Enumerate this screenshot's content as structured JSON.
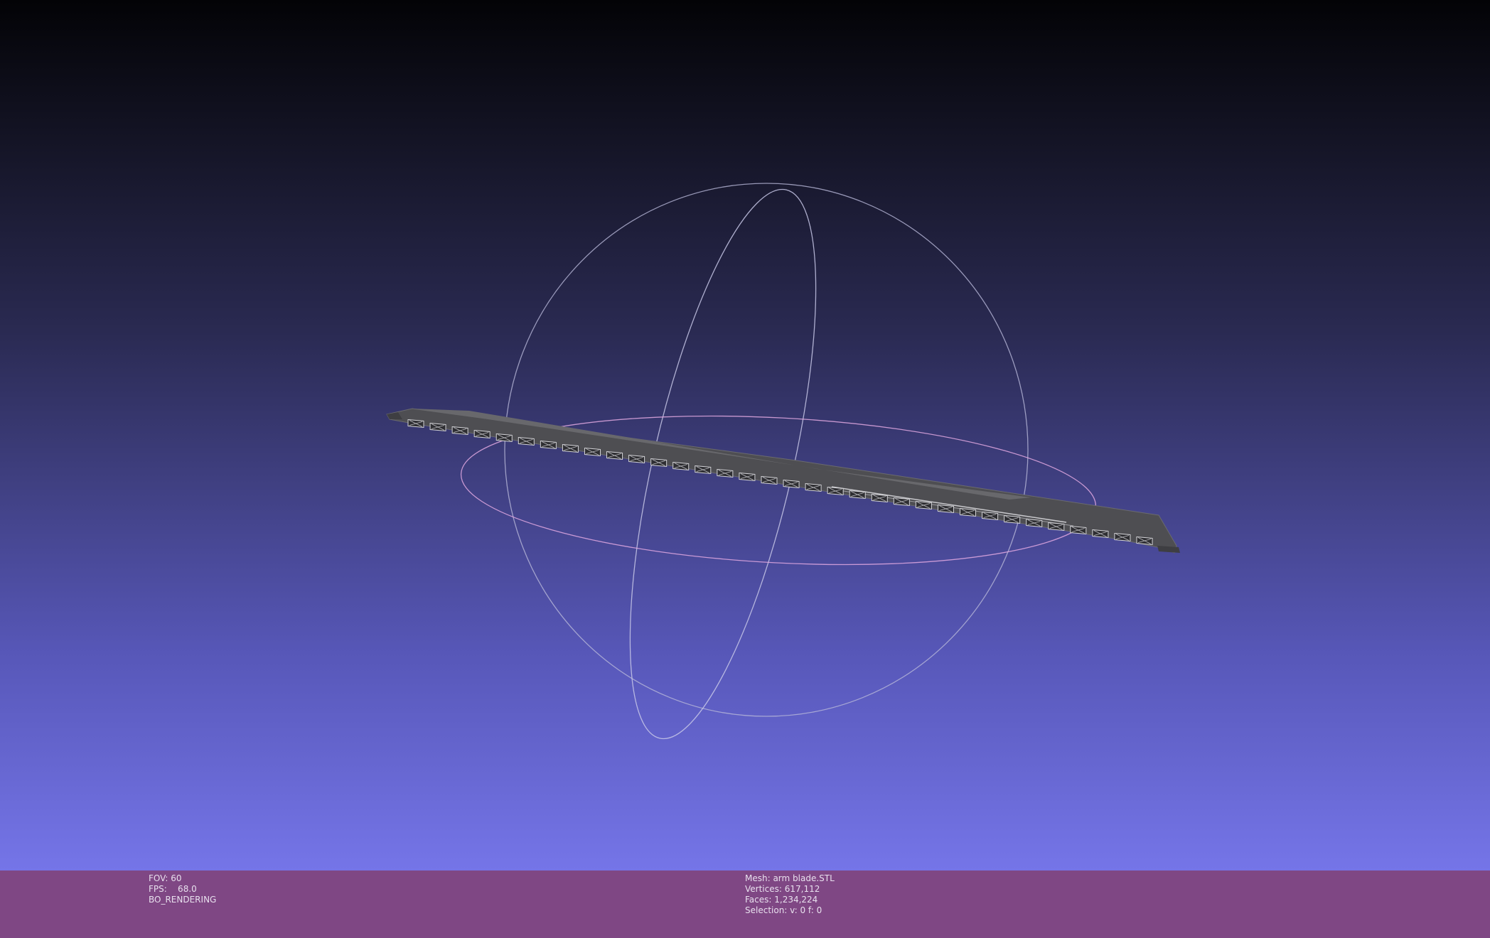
{
  "window": {
    "app": "MeshLab viewer"
  },
  "viewport": {
    "background_top": "#030306",
    "background_bottom": "#7575e8",
    "trackball_color": "#b8b8d8",
    "trackball_equator_color": "#e0a8e0",
    "mesh_color": "#5a5a5e"
  },
  "left_info": {
    "fov": "FOV: 60",
    "fps": "FPS:    68.0",
    "mode": "BO_RENDERING"
  },
  "right_info": {
    "mesh": "Mesh: arm blade.STL",
    "vertices": "Vertices: 617,112",
    "faces": "Faces: 1,234,224",
    "selection": "Selection: v: 0 f: 0"
  },
  "info_bar": {
    "color": "#7f4784"
  }
}
